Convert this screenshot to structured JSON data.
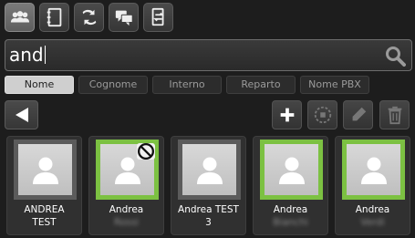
{
  "toolbar": {
    "buttons": [
      {
        "icon": "contacts-icon",
        "active": true
      },
      {
        "icon": "address-book-icon",
        "active": false
      },
      {
        "icon": "call-transfer-icon",
        "active": false
      },
      {
        "icon": "chat-icon",
        "active": false
      },
      {
        "icon": "phone-transfer-icon",
        "active": false
      }
    ]
  },
  "search": {
    "value": "and",
    "icon": "search-icon"
  },
  "filters": [
    {
      "label": "Nome",
      "active": true
    },
    {
      "label": "Cognome",
      "active": false
    },
    {
      "label": "Interno",
      "active": false
    },
    {
      "label": "Reparto",
      "active": false
    },
    {
      "label": "Nome PBX",
      "active": false
    }
  ],
  "actions": {
    "back_icon": "back-arrow-icon",
    "buttons": [
      "add-icon",
      "merge-icon",
      "edit-icon",
      "trash-icon"
    ]
  },
  "colors": {
    "online": "#7cc142",
    "offline": "#5b5b5b",
    "background": "#1d1d1d"
  },
  "contacts": [
    {
      "name": "ANDREA",
      "sub": "TEST",
      "status": "offline",
      "dnd": false,
      "sub_blurred": false
    },
    {
      "name": "Andrea",
      "sub": "Rossi",
      "status": "online",
      "dnd": true,
      "sub_blurred": true
    },
    {
      "name": "Andrea TEST",
      "sub": "3",
      "status": "offline",
      "dnd": false,
      "sub_blurred": false
    },
    {
      "name": "Andrea",
      "sub": "Bianchi",
      "status": "online",
      "dnd": false,
      "sub_blurred": true
    },
    {
      "name": "Andrea",
      "sub": "Verdi",
      "status": "online",
      "dnd": false,
      "sub_blurred": true
    }
  ]
}
